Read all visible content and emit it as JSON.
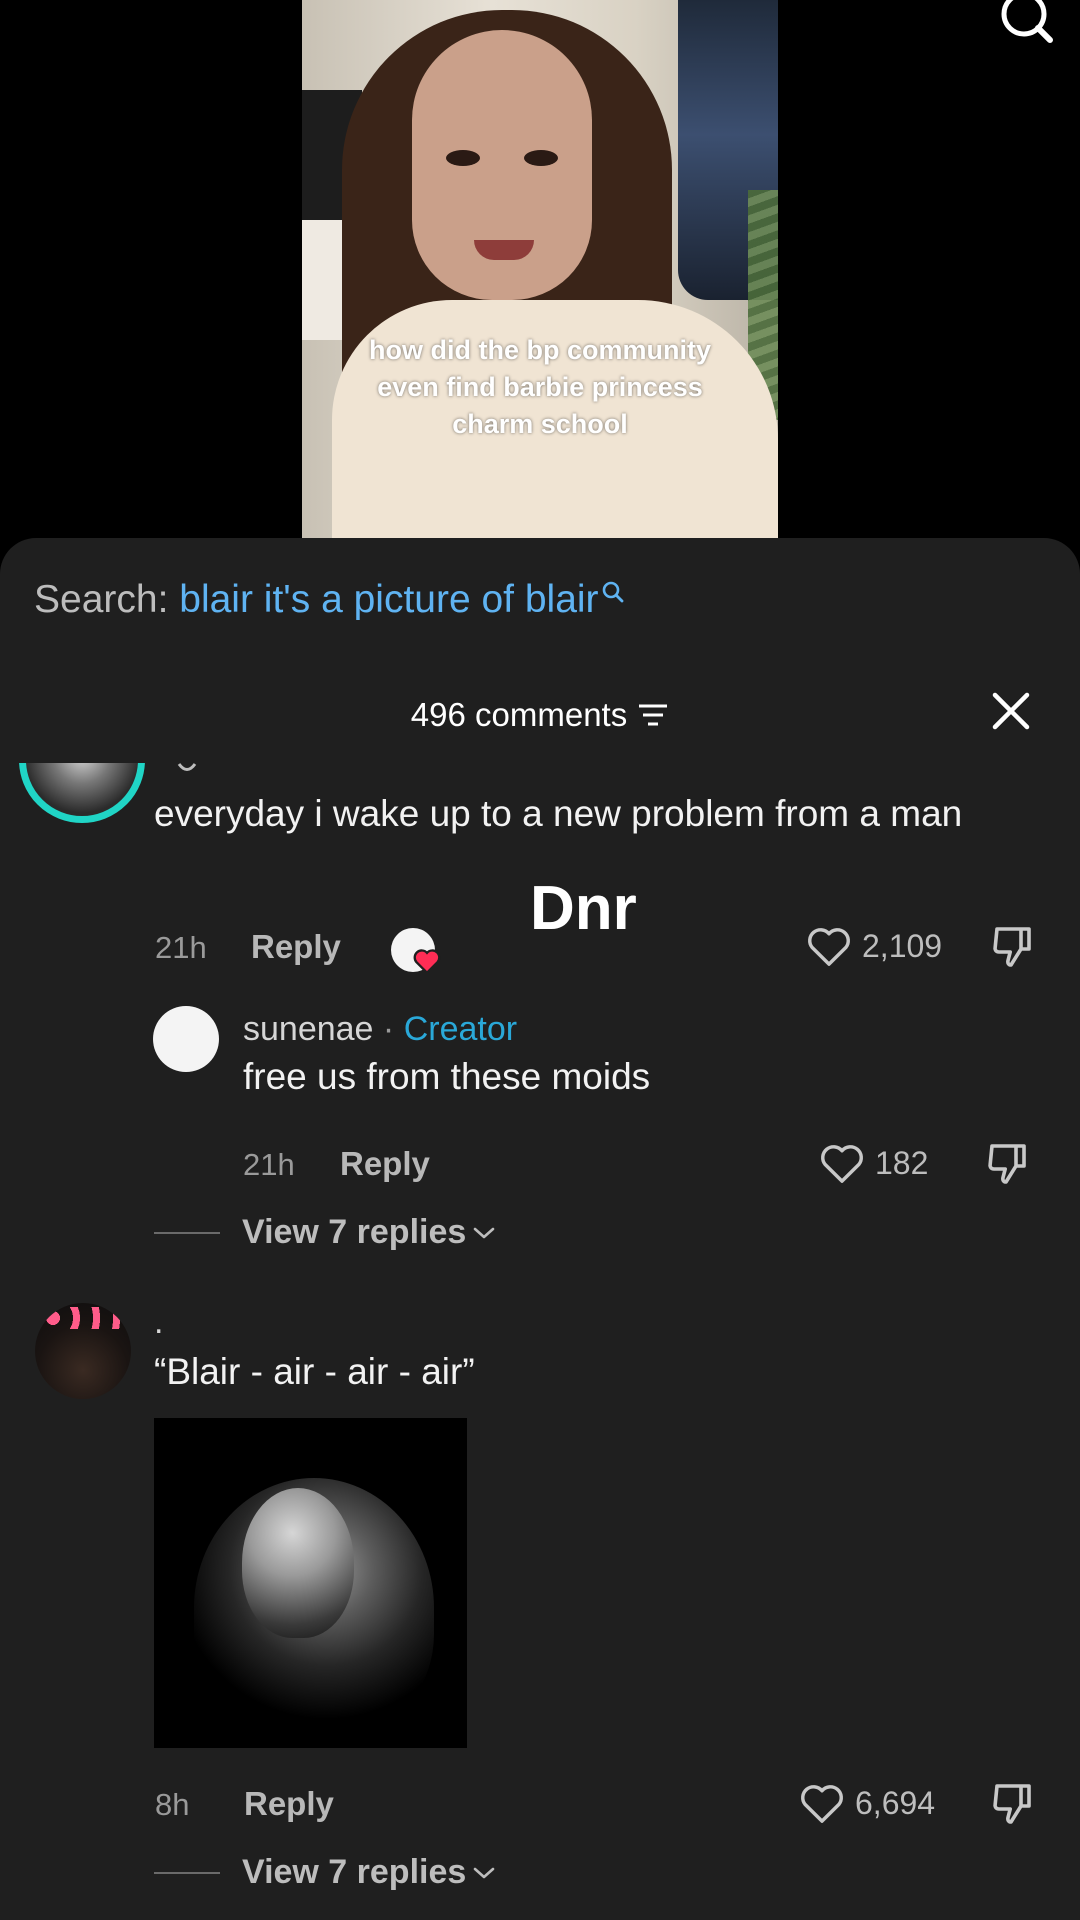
{
  "video": {
    "caption_line1": "how did the bp community",
    "caption_line2": "even find barbie princess",
    "caption_line3": "charm school"
  },
  "search": {
    "prefix": "Search: ",
    "query": "blair it's a picture of blair"
  },
  "header": {
    "comments_count": "496 comments"
  },
  "comments": [
    {
      "text": "everyday i wake up to a new problem from a man",
      "time": "21h",
      "reply_label": "Reply",
      "likes": "2,109",
      "overlay": "Dnr"
    },
    {
      "username": "sunenae",
      "separator": " · ",
      "badge": "Creator",
      "text": "free us from these moids",
      "time": "21h",
      "reply_label": "Reply",
      "likes": "182",
      "view_replies": "View 7 replies"
    },
    {
      "username": ".",
      "text": "“Blair - air - air - air”",
      "time": "8h",
      "reply_label": "Reply",
      "likes": "6,694",
      "view_replies": "View 7 replies"
    }
  ],
  "colors": {
    "sheet_bg": "#1f1f1f",
    "search_query": "#5fb3f2",
    "creator_badge": "#2aa8d8",
    "like_heart": "#ff2d55"
  }
}
